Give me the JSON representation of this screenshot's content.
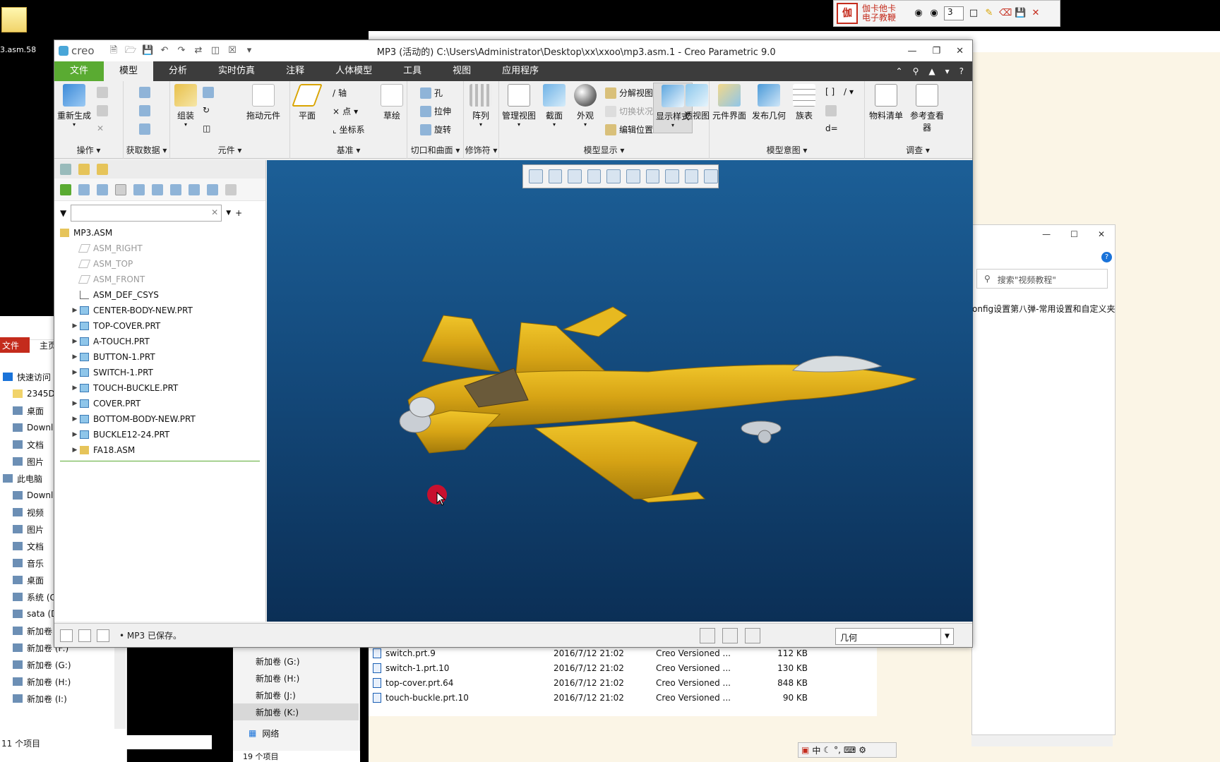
{
  "desktop": {
    "icon_label": "3.asm.58"
  },
  "gaga": {
    "brand_line1": "伽卡他卡",
    "brand_line2": "电子教鞭",
    "logo_text": "伽",
    "pen_size": "3"
  },
  "creo": {
    "logo": "creo",
    "title": "MP3 (活动的) C:\\Users\\Administrator\\Desktop\\xx\\xxoo\\mp3.asm.1 - Creo Parametric 9.0",
    "tabs": [
      "文件",
      "模型",
      "分析",
      "实时仿真",
      "注释",
      "人体模型",
      "工具",
      "视图",
      "应用程序"
    ],
    "groups": {
      "ops": "操作",
      "getdata": "获取数据",
      "component": "元件",
      "datum": "基准",
      "cut": "切口和曲面",
      "modifier": "修饰符",
      "display": "模型显示",
      "intent": "模型意图",
      "investigate": "调查"
    },
    "buttons": {
      "regen": "重新生成",
      "assemble": "组装",
      "drag": "拖动元件",
      "plane": "平面",
      "axis": "轴",
      "point": "点",
      "csys": "坐标系",
      "sketch": "草绘",
      "hole": "孔",
      "extrude": "拉伸",
      "revolve": "旋转",
      "pattern": "阵列",
      "manage_views": "管理视图",
      "section": "截面",
      "appearance": "外观",
      "explode": "分解视图",
      "toggle_state": "切换状况",
      "edit_pos": "编辑位置",
      "display_style": "显示样式",
      "perspective": "透视图",
      "comp_interface": "元件界面",
      "publish_geom": "发布几何",
      "family": "族表",
      "bom": "物料清单",
      "ref_viewer": "参考查看器"
    },
    "tree": {
      "root": "MP3.ASM",
      "items": [
        {
          "name": "ASM_RIGHT",
          "kind": "datum"
        },
        {
          "name": "ASM_TOP",
          "kind": "datum"
        },
        {
          "name": "ASM_FRONT",
          "kind": "datum"
        },
        {
          "name": "ASM_DEF_CSYS",
          "kind": "csys"
        },
        {
          "name": "CENTER-BODY-NEW.PRT",
          "kind": "part"
        },
        {
          "name": "TOP-COVER.PRT",
          "kind": "part"
        },
        {
          "name": "A-TOUCH.PRT",
          "kind": "part"
        },
        {
          "name": "BUTTON-1.PRT",
          "kind": "part"
        },
        {
          "name": "SWITCH-1.PRT",
          "kind": "part"
        },
        {
          "name": "TOUCH-BUCKLE.PRT",
          "kind": "part"
        },
        {
          "name": "COVER.PRT",
          "kind": "part"
        },
        {
          "name": "BOTTOM-BODY-NEW.PRT",
          "kind": "part"
        },
        {
          "name": "BUCKLE12-24.PRT",
          "kind": "part"
        },
        {
          "name": "FA18.ASM",
          "kind": "asm"
        }
      ]
    },
    "status_msg": "MP3 已保存。",
    "selection_filter": "几何"
  },
  "explorer": {
    "file_tab": "文件",
    "home_tab": "主页",
    "nav": [
      "快速访问",
      "2345D",
      "桌面",
      "Downl",
      "文档",
      "图片",
      "此电脑",
      "Downl",
      "视频",
      "图片",
      "文档",
      "音乐",
      "桌面",
      "系统 (C",
      "sata (D",
      "新加卷 (E:)",
      "新加卷 (F:)",
      "新加卷 (G:)",
      "新加卷 (H:)",
      "新加卷 (I:)"
    ],
    "status": "11 个项目"
  },
  "mid_explorer": {
    "drives": [
      "新加卷 (G:)",
      "新加卷 (H:)",
      "新加卷 (J:)",
      "新加卷 (K:)"
    ],
    "network": "网络",
    "status": "19 个项目"
  },
  "files": [
    {
      "name": "switch.prt.9",
      "date": "2016/7/12 21:02",
      "type": "Creo Versioned ...",
      "size": "112 KB"
    },
    {
      "name": "switch-1.prt.10",
      "date": "2016/7/12 21:02",
      "type": "Creo Versioned ...",
      "size": "130 KB"
    },
    {
      "name": "top-cover.prt.64",
      "date": "2016/7/12 21:02",
      "type": "Creo Versioned ...",
      "size": "848 KB"
    },
    {
      "name": "touch-buckle.prt.10",
      "date": "2016/7/12 21:02",
      "type": "Creo Versioned ...",
      "size": "90 KB"
    }
  ],
  "dialog": {
    "search_placeholder": "搜索\"视频教程\"",
    "item": "onfig设置第八弹-常用设置和自定义夹"
  },
  "ime": {
    "lang": "中"
  }
}
